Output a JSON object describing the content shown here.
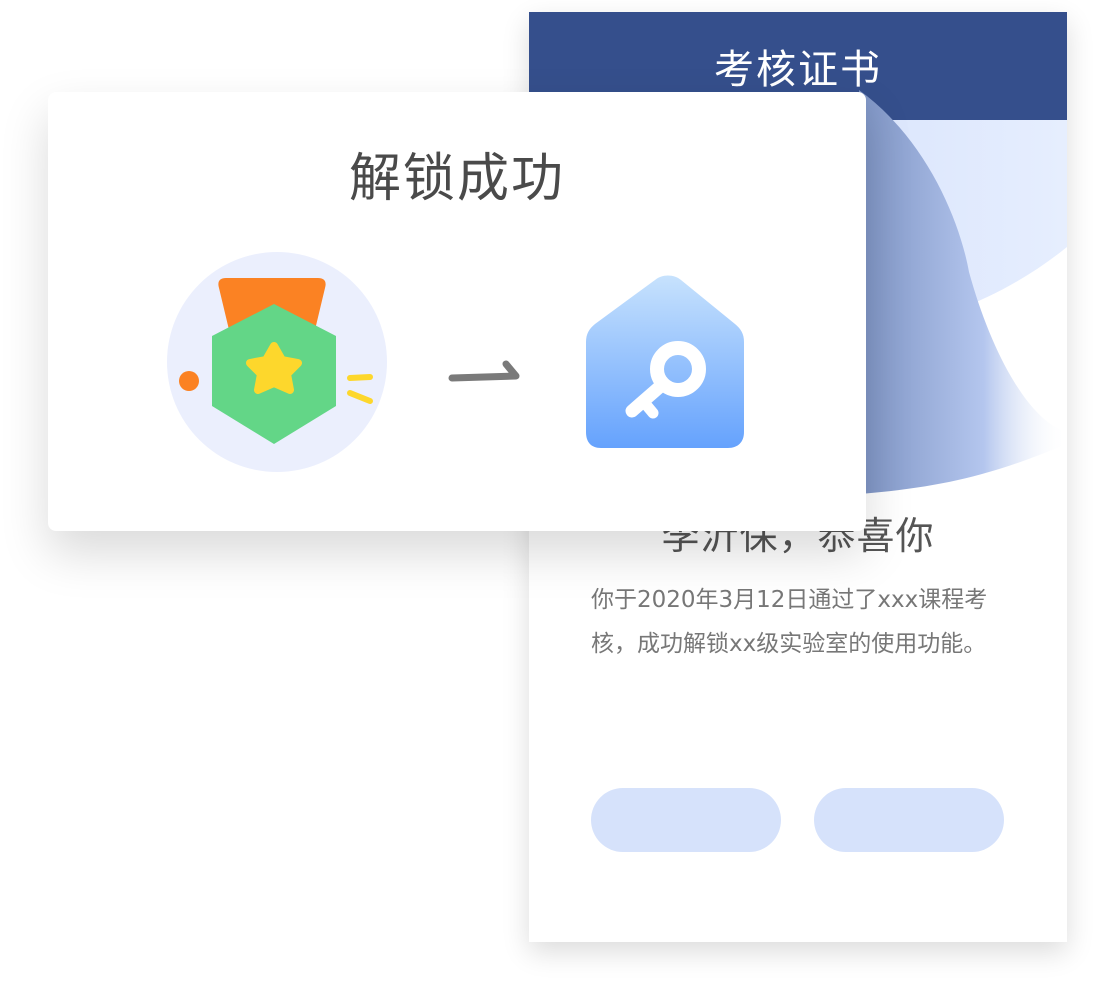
{
  "certificate": {
    "header_title": "考核证书",
    "greeting": "李沂保，恭喜你",
    "body_text": "你于2020年3月12日通过了xxx课程考核，成功解锁xx级实验室的使用功能。",
    "header_color": "#354f8c",
    "button_color": "#d6e2fb"
  },
  "popup": {
    "title": "解锁成功",
    "icons": {
      "badge": "medal-star-icon",
      "arrow": "arrow-right-icon",
      "unlocked": "key-house-icon"
    }
  }
}
